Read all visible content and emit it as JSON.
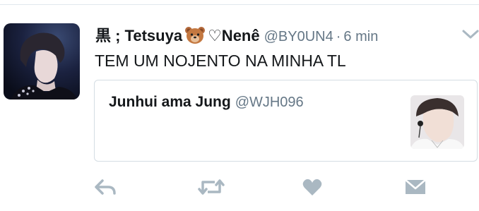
{
  "tweet": {
    "display_name": "黒 ; Tetsuya",
    "display_name_suffix": "♡Nenê",
    "handle": "@BY0UN4",
    "separator": "·",
    "time": "6 min",
    "text": "TEM UM NOJENTO NA MINHA TL",
    "icons": {
      "avatar": "user-avatar",
      "name_emoji": "bear-face-emoji",
      "menu": "chevron-down-icon"
    }
  },
  "quoted_tweet": {
    "display_name": "Junhui ama Jung",
    "handle": "@WJH096",
    "thumbnail": "quoted-avatar-image"
  },
  "actions": [
    {
      "name": "reply",
      "icon": "reply-icon"
    },
    {
      "name": "retweet",
      "icon": "retweet-icon"
    },
    {
      "name": "like",
      "icon": "heart-icon"
    },
    {
      "name": "direct-message",
      "icon": "envelope-icon"
    }
  ],
  "colors": {
    "text": "#14171a",
    "secondary": "#657786",
    "icon_gray": "#aab8c2",
    "border": "#d4dde3"
  }
}
